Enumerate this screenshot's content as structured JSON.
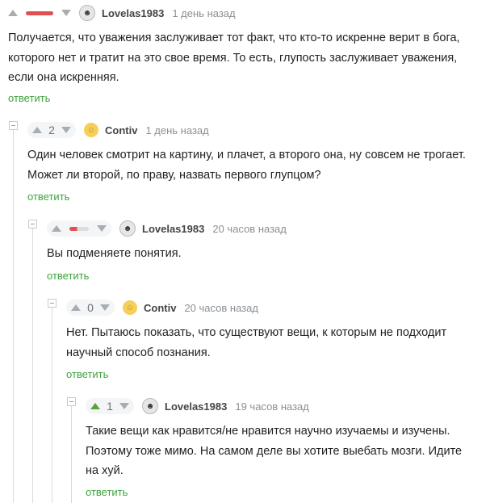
{
  "comments": [
    {
      "rating_display": "",
      "user": "Lovelas1983",
      "time": "1 день назад",
      "lines": [
        "Получается, что уважения заслуживает тот факт, что кто-то искренне верит в бога,",
        "которого нет и тратит на это свое время. То есть, глупость заслуживает уважения,",
        "если она искренняя."
      ],
      "reply": "ответить"
    },
    {
      "rating_display": "2",
      "user": "Contiv",
      "time": "1 день назад",
      "lines": [
        "Один человек смотрит на картину, и плачет, а второго она, ну совсем не трогает.",
        "Может ли второй, по праву, назвать первого глупцом?"
      ],
      "reply": "ответить"
    },
    {
      "rating_display": "",
      "user": "Lovelas1983",
      "time": "20 часов назад",
      "lines": [
        "Вы подменяете понятия."
      ],
      "reply": "ответить"
    },
    {
      "rating_display": "0",
      "user": "Contiv",
      "time": "20 часов назад",
      "lines": [
        "Нет. Пытаюсь показать, что существуют вещи, к которым не подходит",
        "научный способ познания."
      ],
      "reply": "ответить"
    },
    {
      "rating_display": "1",
      "user": "Lovelas1983",
      "time": "19 часов назад",
      "lines": [
        "Такие вещи как нравится/не нравится научно изучаемы и изучены.",
        "Поэтому тоже мимо. На самом деле вы хотите выебать мозги. Идите",
        "на хуй."
      ],
      "reply": "ответить"
    }
  ],
  "icons": {
    "lovelas_avatar": "dark-mask-avatar-icon",
    "contiv_avatar": "yellow-face-avatar-icon"
  },
  "colors": {
    "reply_link": "#3ea33e",
    "negative_bar": "#e05050",
    "upvote_active": "#5aa33c"
  }
}
